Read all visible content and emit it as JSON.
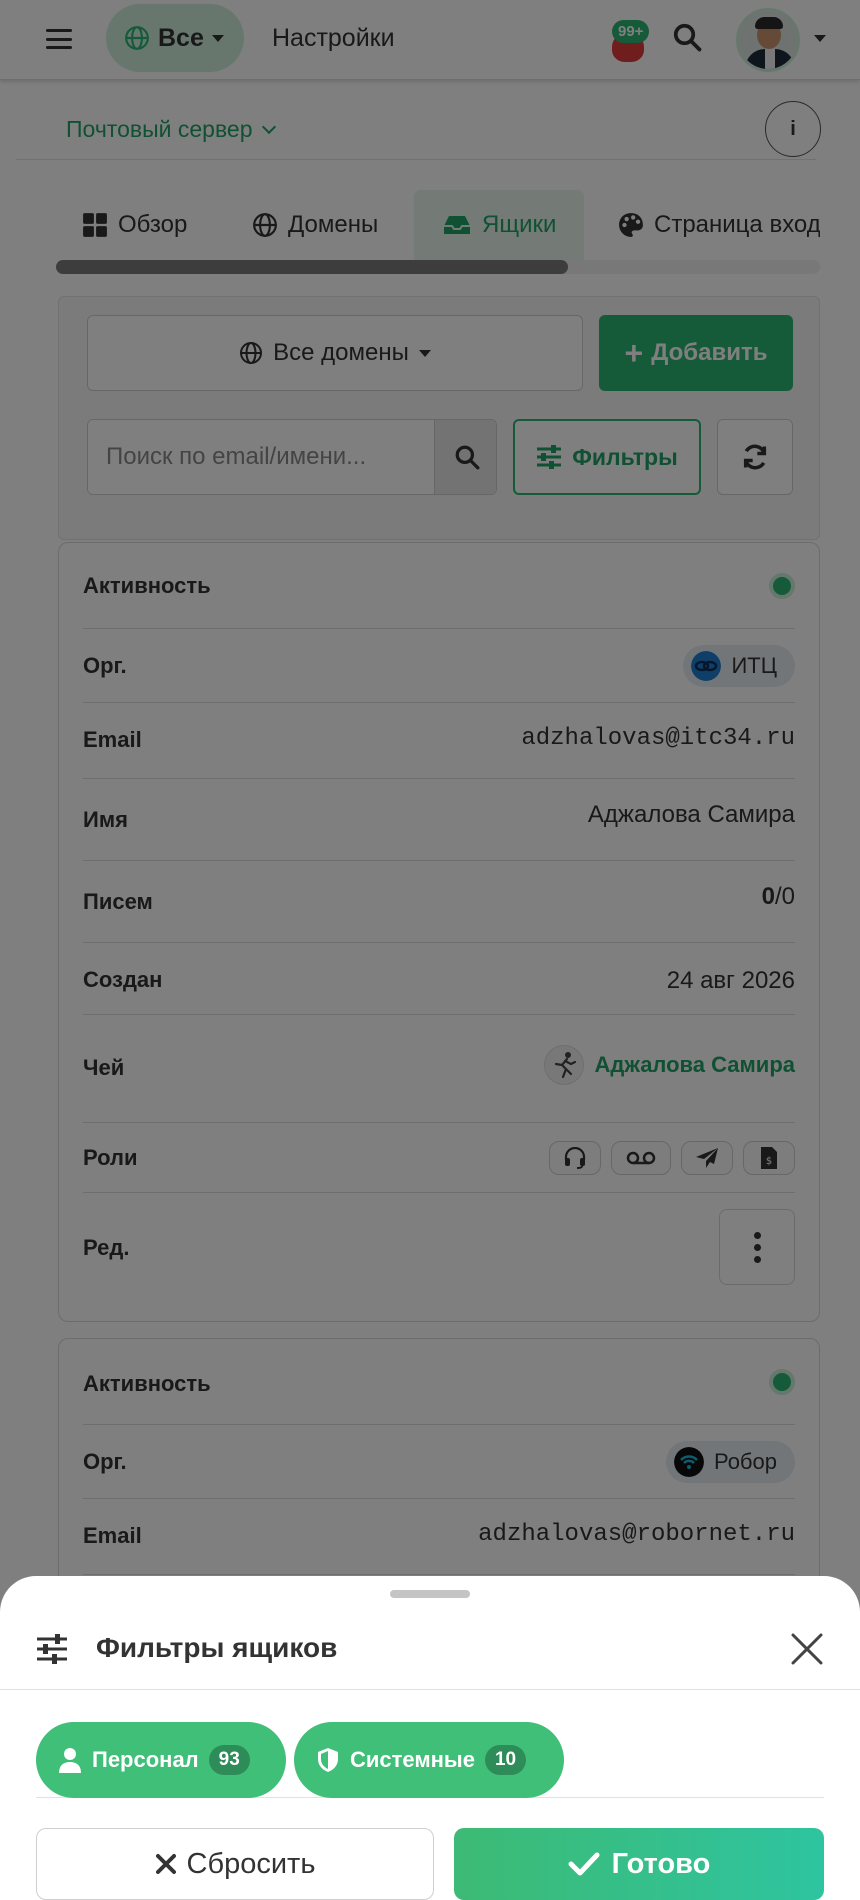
{
  "topbar": {
    "scope_label": "Все",
    "page_title": "Настройки",
    "notifications_count": "99+"
  },
  "subbar": {
    "section_label": "Почтовый сервер",
    "info_label": "i"
  },
  "tabs": [
    {
      "label": "Обзор",
      "icon": "grid-icon"
    },
    {
      "label": "Домены",
      "icon": "globe-icon"
    },
    {
      "label": "Ящики",
      "icon": "inbox-icon",
      "active": true
    },
    {
      "label": "Страница вход",
      "icon": "palette-icon"
    }
  ],
  "toolbar": {
    "domains_label": "Все домены",
    "add_label": "Добавить",
    "search_placeholder": "Поиск по email/имени...",
    "filters_label": "Фильтры"
  },
  "field_labels": {
    "active": "Активность",
    "org": "Орг.",
    "email": "Email",
    "name": "Имя",
    "letters": "Писем",
    "created": "Создан",
    "owner": "Чей",
    "roles": "Роли",
    "edit": "Ред."
  },
  "mailboxes": [
    {
      "active": true,
      "org": "ИТЦ",
      "email": "adzhalovas@itc34.ru",
      "name": "Аджалова Самира",
      "letters_unread": "0",
      "letters_total": "/0",
      "created": "24 авг 2026",
      "owner": "Аджалова Самира",
      "roles": [
        "headset-icon",
        "voicemail-icon",
        "send-icon",
        "invoice-icon"
      ]
    },
    {
      "active": true,
      "org": "Робор",
      "email": "adzhalovas@robornet.ru"
    }
  ],
  "filter_sheet": {
    "title": "Фильтры ящиков",
    "chips": [
      {
        "label": "Персонал",
        "count": "93",
        "icon": "user-icon"
      },
      {
        "label": "Системные",
        "count": "10",
        "icon": "shield-icon"
      }
    ],
    "reset_label": "Сбросить",
    "done_label": "Готово"
  },
  "colors": {
    "accent": "#2bb673",
    "email": "#d63384",
    "notification": "#e03b3b"
  }
}
